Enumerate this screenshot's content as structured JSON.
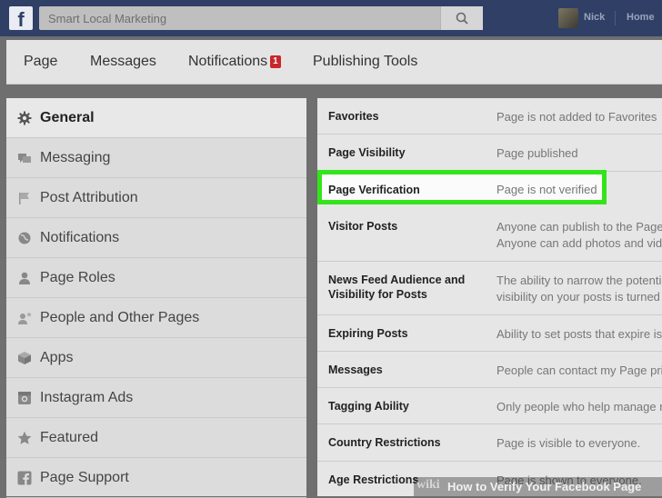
{
  "topbar": {
    "logo": "f",
    "search_value": "Smart Local Marketing",
    "user_name": "Nick",
    "home_label": "Home"
  },
  "tabs": [
    {
      "label": "Page"
    },
    {
      "label": "Messages"
    },
    {
      "label": "Notifications",
      "badge": "1"
    },
    {
      "label": "Publishing Tools"
    }
  ],
  "sidebar": {
    "items": [
      {
        "label": "General",
        "icon": "gear-icon",
        "active": true
      },
      {
        "label": "Messaging",
        "icon": "chat-bubbles-icon"
      },
      {
        "label": "Post Attribution",
        "icon": "flag-icon"
      },
      {
        "label": "Notifications",
        "icon": "globe-icon"
      },
      {
        "label": "Page Roles",
        "icon": "person-icon"
      },
      {
        "label": "People and Other Pages",
        "icon": "person-star-icon"
      },
      {
        "label": "Apps",
        "icon": "cube-icon"
      },
      {
        "label": "Instagram Ads",
        "icon": "instagram-icon"
      },
      {
        "label": "Featured",
        "icon": "star-icon"
      },
      {
        "label": "Page Support",
        "icon": "facebook-icon"
      }
    ]
  },
  "settings": {
    "rows": [
      {
        "name": "Favorites",
        "value": "Page is not added to Favorites"
      },
      {
        "name": "Page Visibility",
        "value": "Page published"
      },
      {
        "name": "Page Verification",
        "value": "Page is not verified",
        "highlighted": true
      },
      {
        "name": "Visitor Posts",
        "value": "Anyone can publish to the Page",
        "value2": "Anyone can add photos and vide"
      },
      {
        "name": "News Feed Audience and Visibility for Posts",
        "value": "The ability to narrow the potenti",
        "value2": "visibility on your posts is turned"
      },
      {
        "name": "Expiring Posts",
        "value": "Ability to set posts that expire is"
      },
      {
        "name": "Messages",
        "value": "People can contact my Page pri"
      },
      {
        "name": "Tagging Ability",
        "value": "Only people who help manage m"
      },
      {
        "name": "Country Restrictions",
        "value": "Page is visible to everyone."
      },
      {
        "name": "Age Restrictions",
        "value": "Page is shown to everyone."
      }
    ]
  },
  "caption": {
    "wiki": "wiki",
    "title": "How to Verify Your Facebook Page"
  },
  "colors": {
    "topbar": "#2f3f66",
    "highlight": "#33e41b",
    "badge": "#c8262b"
  }
}
